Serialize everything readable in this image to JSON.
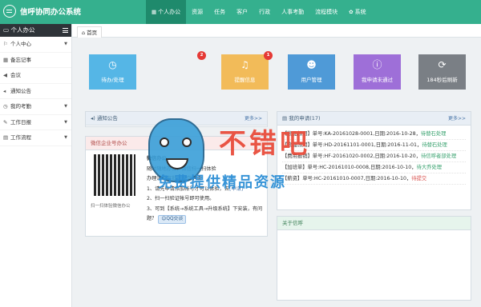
{
  "app": {
    "title": "信呼协同办公系统"
  },
  "topnav": [
    {
      "label": "个人办公",
      "icon": "grid-icon",
      "active": true
    },
    {
      "label": "资源"
    },
    {
      "label": "任务"
    },
    {
      "label": "客户"
    },
    {
      "label": "行政"
    },
    {
      "label": "人事考勤"
    },
    {
      "label": "流程模块"
    },
    {
      "label": "系统",
      "icon": "gear-icon"
    }
  ],
  "sidebar": {
    "header": "个人办公",
    "items": [
      {
        "label": "个人中心",
        "icon": "flag-icon",
        "caret": true
      },
      {
        "label": "备忘记事",
        "icon": "calendar-icon",
        "caret": false
      },
      {
        "label": "会议",
        "icon": "megaphone-icon",
        "caret": false
      },
      {
        "label": "通知公告",
        "icon": "speaker-icon",
        "caret": false
      },
      {
        "label": "我的考勤",
        "icon": "clock-icon",
        "caret": true
      },
      {
        "label": "工作日报",
        "icon": "edit-icon",
        "caret": true
      },
      {
        "label": "工作流程",
        "icon": "folder-icon",
        "caret": true
      }
    ]
  },
  "tabs": {
    "home": "首页"
  },
  "tiles": [
    {
      "label": "待办/处理",
      "color": "#55b6e6",
      "icon": "clock-icon",
      "badge": ""
    },
    {
      "label": "提醒信息",
      "color": "#f2bb59",
      "icon": "bell-icon",
      "badge": "2"
    },
    {
      "label": "用户管理",
      "color": "#4f9ad7",
      "icon": "user-icon",
      "badge": "1"
    },
    {
      "label": "我申请未通过",
      "color": "#9e6fd8",
      "icon": "info-icon",
      "badge": ""
    },
    {
      "label": "184秒后刷新",
      "color": "#7a7f85",
      "icon": "refresh-icon",
      "badge": ""
    }
  ],
  "notice": {
    "title": "通知公告",
    "more": "更多>>"
  },
  "wechat": {
    "title": "微信企业号办公",
    "qr_caption": "扫一扫体验微信办公",
    "heading": "微信办公",
    "lines": [
      "随时随地办公，微信扫一扫体验",
      "办理流程审批，提交申请",
      "1、请先申请添加帐号才可以体验，去",
      "2、扫一扫验证帐号即可使用。",
      "3、可到【系统→系统工具→升级系统】下安装，有问题？"
    ],
    "apply_link": "[申请]",
    "qq_label": "QQ交谈"
  },
  "my_apps": {
    "title": "我的申请(17)",
    "more": "更多>>",
    "rows": [
      {
        "text": "【物品领用】单号:KA-20161028-0001,日期:2016-10-28，",
        "status": "待替石处理",
        "status_red": false
      },
      {
        "text": "【物品领用】单号:HD-20161101-0001,日期:2016-11-01，",
        "status": "待替石处理",
        "status_red": false
      },
      {
        "text": "【费用报销】单号:HF-20161020-0002,日期:2016-10-20，",
        "status": "待信呼者部处理",
        "status_red": false
      },
      {
        "text": "【加班单】单号:HC-20161010-0008,日期:2016-10-10，",
        "status": "待大乔处理",
        "status_red": false
      },
      {
        "text": "【薪资】单号:HC-20161010-0007,日期:2016-10-10，",
        "status": "待提交",
        "status_red": true
      }
    ]
  },
  "about": {
    "title": "关于信呼"
  },
  "watermark": {
    "title": "不错吧",
    "subtitle": "免费提供精品资源"
  }
}
